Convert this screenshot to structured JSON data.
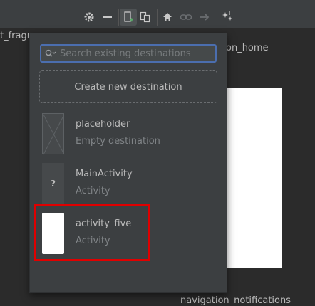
{
  "toolbar": {
    "icons": [
      "gear-icon",
      "minus-icon",
      "new-destination-icon",
      "duplicate-icon",
      "home-icon",
      "link-icon",
      "arrow-right-icon",
      "magic-wand-icon"
    ]
  },
  "background": {
    "left_label": "t_fragn",
    "right_label": "on_home",
    "bottom_label": "navigation_notifications"
  },
  "popup": {
    "search_placeholder": "Search existing destinations",
    "create_label": "Create new destination",
    "destinations": [
      {
        "name": "placeholder",
        "type": "Empty destination"
      },
      {
        "name": "MainActivity",
        "type": "Activity",
        "thumb_glyph": "?"
      },
      {
        "name": "activity_five",
        "type": "Activity"
      }
    ]
  },
  "colors": {
    "accent": "#4b6eaf",
    "highlight": "#e00000",
    "panel": "#3c3f41"
  }
}
